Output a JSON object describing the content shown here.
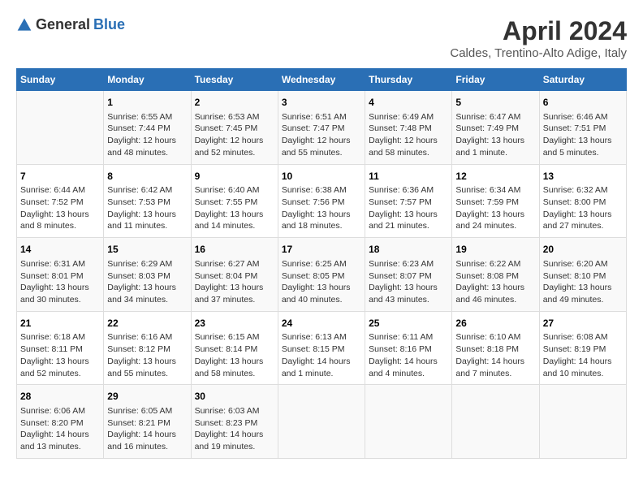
{
  "logo": {
    "general": "General",
    "blue": "Blue"
  },
  "title": "April 2024",
  "subtitle": "Caldes, Trentino-Alto Adige, Italy",
  "days_header": [
    "Sunday",
    "Monday",
    "Tuesday",
    "Wednesday",
    "Thursday",
    "Friday",
    "Saturday"
  ],
  "weeks": [
    [
      {
        "num": "",
        "info": ""
      },
      {
        "num": "1",
        "info": "Sunrise: 6:55 AM\nSunset: 7:44 PM\nDaylight: 12 hours\nand 48 minutes."
      },
      {
        "num": "2",
        "info": "Sunrise: 6:53 AM\nSunset: 7:45 PM\nDaylight: 12 hours\nand 52 minutes."
      },
      {
        "num": "3",
        "info": "Sunrise: 6:51 AM\nSunset: 7:47 PM\nDaylight: 12 hours\nand 55 minutes."
      },
      {
        "num": "4",
        "info": "Sunrise: 6:49 AM\nSunset: 7:48 PM\nDaylight: 12 hours\nand 58 minutes."
      },
      {
        "num": "5",
        "info": "Sunrise: 6:47 AM\nSunset: 7:49 PM\nDaylight: 13 hours\nand 1 minute."
      },
      {
        "num": "6",
        "info": "Sunrise: 6:46 AM\nSunset: 7:51 PM\nDaylight: 13 hours\nand 5 minutes."
      }
    ],
    [
      {
        "num": "7",
        "info": "Sunrise: 6:44 AM\nSunset: 7:52 PM\nDaylight: 13 hours\nand 8 minutes."
      },
      {
        "num": "8",
        "info": "Sunrise: 6:42 AM\nSunset: 7:53 PM\nDaylight: 13 hours\nand 11 minutes."
      },
      {
        "num": "9",
        "info": "Sunrise: 6:40 AM\nSunset: 7:55 PM\nDaylight: 13 hours\nand 14 minutes."
      },
      {
        "num": "10",
        "info": "Sunrise: 6:38 AM\nSunset: 7:56 PM\nDaylight: 13 hours\nand 18 minutes."
      },
      {
        "num": "11",
        "info": "Sunrise: 6:36 AM\nSunset: 7:57 PM\nDaylight: 13 hours\nand 21 minutes."
      },
      {
        "num": "12",
        "info": "Sunrise: 6:34 AM\nSunset: 7:59 PM\nDaylight: 13 hours\nand 24 minutes."
      },
      {
        "num": "13",
        "info": "Sunrise: 6:32 AM\nSunset: 8:00 PM\nDaylight: 13 hours\nand 27 minutes."
      }
    ],
    [
      {
        "num": "14",
        "info": "Sunrise: 6:31 AM\nSunset: 8:01 PM\nDaylight: 13 hours\nand 30 minutes."
      },
      {
        "num": "15",
        "info": "Sunrise: 6:29 AM\nSunset: 8:03 PM\nDaylight: 13 hours\nand 34 minutes."
      },
      {
        "num": "16",
        "info": "Sunrise: 6:27 AM\nSunset: 8:04 PM\nDaylight: 13 hours\nand 37 minutes."
      },
      {
        "num": "17",
        "info": "Sunrise: 6:25 AM\nSunset: 8:05 PM\nDaylight: 13 hours\nand 40 minutes."
      },
      {
        "num": "18",
        "info": "Sunrise: 6:23 AM\nSunset: 8:07 PM\nDaylight: 13 hours\nand 43 minutes."
      },
      {
        "num": "19",
        "info": "Sunrise: 6:22 AM\nSunset: 8:08 PM\nDaylight: 13 hours\nand 46 minutes."
      },
      {
        "num": "20",
        "info": "Sunrise: 6:20 AM\nSunset: 8:10 PM\nDaylight: 13 hours\nand 49 minutes."
      }
    ],
    [
      {
        "num": "21",
        "info": "Sunrise: 6:18 AM\nSunset: 8:11 PM\nDaylight: 13 hours\nand 52 minutes."
      },
      {
        "num": "22",
        "info": "Sunrise: 6:16 AM\nSunset: 8:12 PM\nDaylight: 13 hours\nand 55 minutes."
      },
      {
        "num": "23",
        "info": "Sunrise: 6:15 AM\nSunset: 8:14 PM\nDaylight: 13 hours\nand 58 minutes."
      },
      {
        "num": "24",
        "info": "Sunrise: 6:13 AM\nSunset: 8:15 PM\nDaylight: 14 hours\nand 1 minute."
      },
      {
        "num": "25",
        "info": "Sunrise: 6:11 AM\nSunset: 8:16 PM\nDaylight: 14 hours\nand 4 minutes."
      },
      {
        "num": "26",
        "info": "Sunrise: 6:10 AM\nSunset: 8:18 PM\nDaylight: 14 hours\nand 7 minutes."
      },
      {
        "num": "27",
        "info": "Sunrise: 6:08 AM\nSunset: 8:19 PM\nDaylight: 14 hours\nand 10 minutes."
      }
    ],
    [
      {
        "num": "28",
        "info": "Sunrise: 6:06 AM\nSunset: 8:20 PM\nDaylight: 14 hours\nand 13 minutes."
      },
      {
        "num": "29",
        "info": "Sunrise: 6:05 AM\nSunset: 8:21 PM\nDaylight: 14 hours\nand 16 minutes."
      },
      {
        "num": "30",
        "info": "Sunrise: 6:03 AM\nSunset: 8:23 PM\nDaylight: 14 hours\nand 19 minutes."
      },
      {
        "num": "",
        "info": ""
      },
      {
        "num": "",
        "info": ""
      },
      {
        "num": "",
        "info": ""
      },
      {
        "num": "",
        "info": ""
      }
    ]
  ]
}
